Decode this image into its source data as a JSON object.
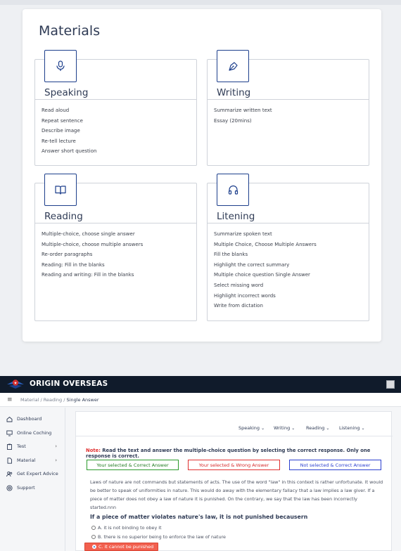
{
  "materials": {
    "title": "Materials",
    "cards": [
      {
        "title": "Speaking",
        "icon": "microphone-icon",
        "items": [
          "Read aloud",
          "Repeat sentence",
          "Describe image",
          "Re-tell lecture",
          "Answer short question"
        ]
      },
      {
        "title": "Writing",
        "icon": "pen-nib-icon",
        "items": [
          "Summarize written text",
          "Essay (20mins)"
        ]
      },
      {
        "title": "Reading",
        "icon": "book-icon",
        "items": [
          "Multiple-choice, choose single answer",
          "Multiple-choice, choose multiple answers",
          "Re-order paragraphs",
          "Reading: Fill in the blanks",
          "Reading and writing: Fill in the blanks"
        ]
      },
      {
        "title": "Litening",
        "icon": "headphones-icon",
        "items": [
          "Summarize spoken text",
          "Multiple Choice, Choose Multiple Answers",
          "Fill the blanks",
          "Highlight the correct summary",
          "Multiple choice question Single Answer",
          "Select missing word",
          "Highlight incorrect words",
          "Write from dictation"
        ]
      }
    ]
  },
  "app": {
    "brand": "ORIGIN OVERSEAS",
    "breadcrumb": {
      "root": "Material",
      "sep": "/",
      "section": "Reading",
      "current": "Single Answer"
    },
    "sidebar": [
      {
        "label": "Dashboard",
        "icon": "home-icon",
        "has_children": false
      },
      {
        "label": "Online Coching",
        "icon": "monitor-icon",
        "has_children": false
      },
      {
        "label": "Test",
        "icon": "clipboard-icon",
        "has_children": true
      },
      {
        "label": "Material",
        "icon": "file-icon",
        "has_children": true
      },
      {
        "label": "Get Expert Advice",
        "icon": "users-icon",
        "has_children": false
      },
      {
        "label": "Support",
        "icon": "support-icon",
        "has_children": false
      }
    ],
    "tabs": [
      "Speaking",
      "Writing",
      "Reading",
      "Listening"
    ],
    "note": {
      "label": "Note:",
      "text": " Read the text and answer the multiple-choice question by selecting the correct response. Only one response is correct."
    },
    "legend": {
      "correct": "Your selected & Correct Answer",
      "wrong": "Your selected & Wrong Answer",
      "missed": "Not selected & Correct Answer"
    },
    "passage": "Laws of nature are not commands but statements of acts. The use of the word \"law\" in this context is rather unfortunate. It would be better to speak of uniformities in nature. This would do away with the elementary fallacy that a law implies a law giver. If a piece of matter does not obey a law of nature it is punished. On the contrary, we say that the law has been incorrectly started.nnn",
    "question": "If a piece of matter violates nature's law, it is not punished becausern",
    "options": [
      {
        "label": "A. it is not binding to obey it",
        "selected": false
      },
      {
        "label": "B. there is no superior being to enforce the law of nature",
        "selected": false
      },
      {
        "label": "C. it cannot be punished",
        "selected": true
      }
    ],
    "colors": {
      "navbar": "#101b2b",
      "accent": "#1d3f8c",
      "correct": "#2b9a2b",
      "wrong": "#e03131",
      "missed": "#2b3fcf"
    }
  }
}
